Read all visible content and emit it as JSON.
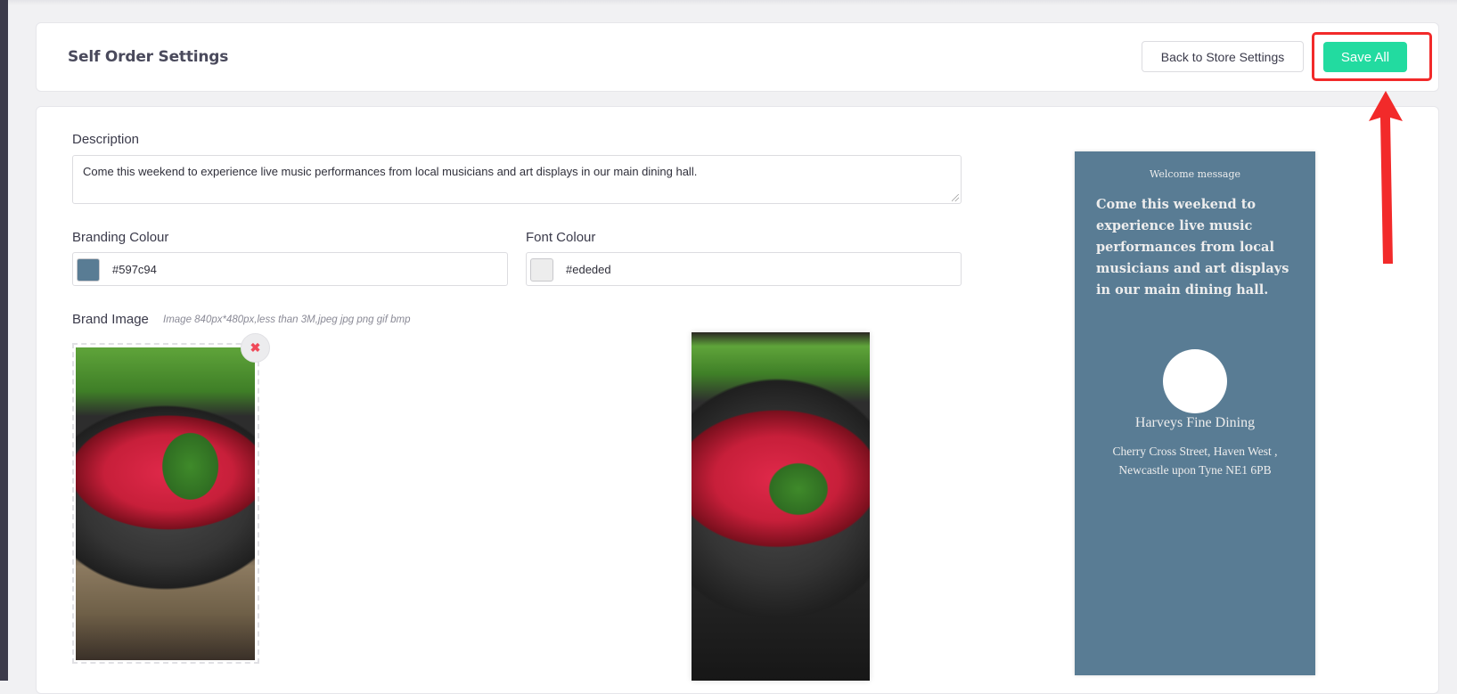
{
  "header": {
    "title": "Self Order Settings",
    "back_label": "Back to Store Settings",
    "save_label": "Save All"
  },
  "form": {
    "description_label": "Description",
    "description_value": "Come this weekend to experience live music performances from local musicians and art displays in our main dining hall.",
    "branding_colour_label": "Branding Colour",
    "branding_colour_value": "#597c94",
    "font_colour_label": "Font Colour",
    "font_colour_value": "#ededed",
    "brand_image_label": "Brand Image",
    "brand_image_hint": "Image 840px*480px,less than 3M,jpeg jpg png gif bmp"
  },
  "preview": {
    "welcome_label": "Welcome message",
    "description": "Come this weekend to experience live music performances from local musicians and art displays in our main dining hall.",
    "store_name": "Harveys Fine Dining",
    "store_address": "Cherry Cross Street, Haven West ,\nNewcastle upon Tyne    NE1 6PB",
    "background_color": "#597c94",
    "text_color": "#ededed"
  },
  "colors": {
    "accent": "#22dba0",
    "highlight": "#f22a2a"
  },
  "icons": {
    "remove": "close-icon",
    "annotation": "arrow-up-icon"
  }
}
